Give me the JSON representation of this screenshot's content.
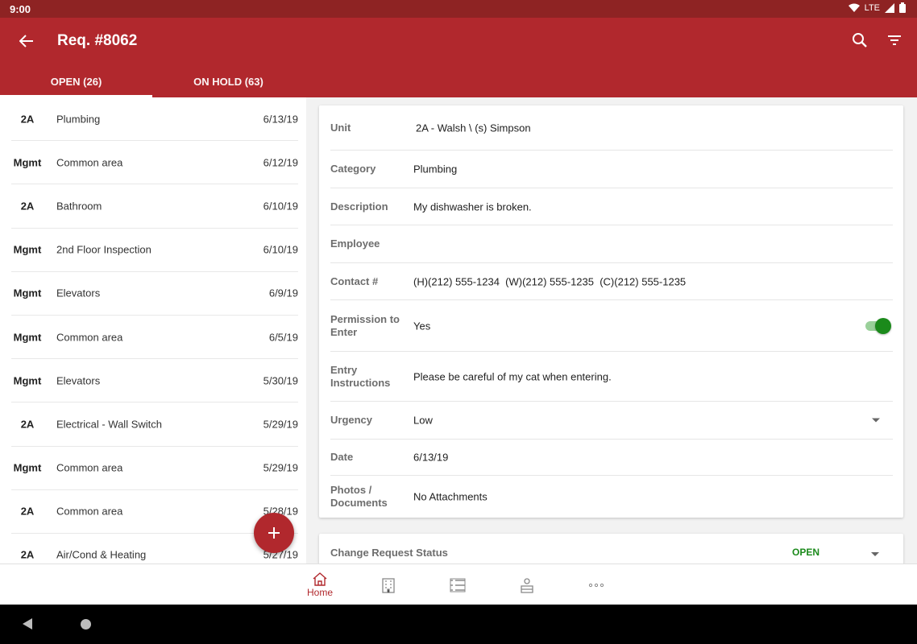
{
  "status_bar": {
    "time": "9:00",
    "network": "LTE"
  },
  "app_bar": {
    "title": "Req. #8062"
  },
  "tabs": [
    {
      "label": "OPEN (26)",
      "active": true
    },
    {
      "label": "ON HOLD (63)",
      "active": false
    }
  ],
  "requests": [
    {
      "unit": "2A",
      "category": "Plumbing",
      "date": "6/13/19"
    },
    {
      "unit": "Mgmt",
      "category": "Common area",
      "date": "6/12/19"
    },
    {
      "unit": "2A",
      "category": "Bathroom",
      "date": "6/10/19"
    },
    {
      "unit": "Mgmt",
      "category": "2nd Floor Inspection",
      "date": "6/10/19"
    },
    {
      "unit": "Mgmt",
      "category": "Elevators",
      "date": "6/9/19"
    },
    {
      "unit": "Mgmt",
      "category": "Common area",
      "date": "6/5/19"
    },
    {
      "unit": "Mgmt",
      "category": "Elevators",
      "date": "5/30/19"
    },
    {
      "unit": "2A",
      "category": "Electrical - Wall Switch",
      "date": "5/29/19"
    },
    {
      "unit": "Mgmt",
      "category": "Common area",
      "date": "5/29/19"
    },
    {
      "unit": "2A",
      "category": "Common area",
      "date": "5/28/19"
    },
    {
      "unit": "2A",
      "category": "Air/Cond & Heating",
      "date": "5/27/19"
    }
  ],
  "details": {
    "unit": {
      "label": "Unit",
      "value": "2A - Walsh \\ (s) Simpson"
    },
    "category": {
      "label": "Category",
      "value": "Plumbing"
    },
    "description": {
      "label": "Description",
      "value": "My dishwasher is broken."
    },
    "employee": {
      "label": "Employee",
      "value": ""
    },
    "contact": {
      "label": "Contact #",
      "value": "(H)(212) 555-1234  (W)(212) 555-1235  (C)(212) 555-1235"
    },
    "permission": {
      "label": "Permission to Enter",
      "value": "Yes",
      "enabled": true
    },
    "entry": {
      "label": "Entry Instructions",
      "value": "Please be careful of my cat when entering."
    },
    "urgency": {
      "label": "Urgency",
      "value": "Low"
    },
    "date": {
      "label": "Date",
      "value": "6/13/19"
    },
    "photos": {
      "label": "Photos / Documents",
      "value": "No Attachments"
    }
  },
  "status_change": {
    "label": "Change Request Status",
    "value": "OPEN"
  },
  "bottom_nav": {
    "home_label": "Home",
    "items": [
      "home-icon",
      "building-icon",
      "list-icon",
      "resident-icon",
      "more-icon"
    ]
  },
  "colors": {
    "primary": "#b1282d",
    "status_bar": "#8e2323",
    "accent_green": "#1b8a1b"
  }
}
